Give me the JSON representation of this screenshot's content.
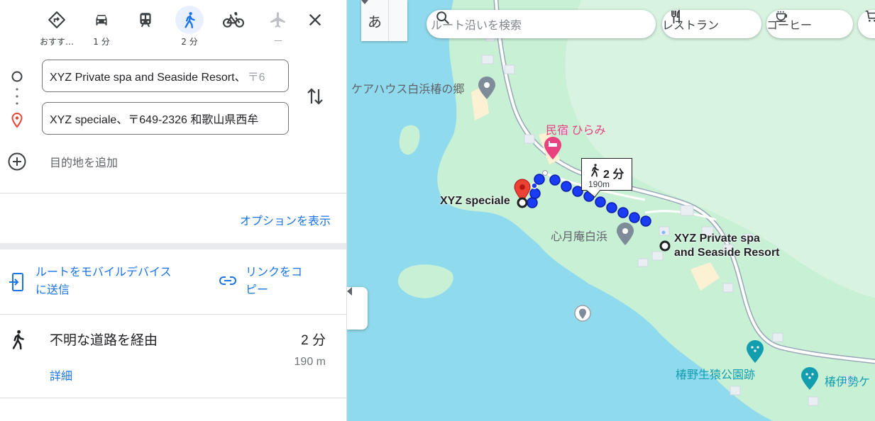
{
  "modes": [
    {
      "name": "best",
      "label": "おすす…"
    },
    {
      "name": "driving",
      "label": "1 分"
    },
    {
      "name": "transit",
      "label": ""
    },
    {
      "name": "walking",
      "label": "2 分"
    },
    {
      "name": "cycling",
      "label": ""
    },
    {
      "name": "flight",
      "label": "—"
    }
  ],
  "active_mode": "walking",
  "origin": {
    "value": "XYZ Private spa and Seaside Resort、",
    "hint": "〒6"
  },
  "destination": {
    "value": "XYZ speciale、〒649-2326 和歌山県西牟"
  },
  "add_destination": "目的地を追加",
  "options_link": "オプションを表示",
  "share_mobile": [
    "ルートをモバイルデバイス",
    "に送信"
  ],
  "share_link": [
    "リンクをコ",
    "ピー"
  ],
  "route": {
    "title": "不明な道路を経由",
    "duration": "2 分",
    "details": "詳細",
    "distance": "190 m"
  },
  "map": {
    "ime_label": "あ",
    "search_placeholder": "ルート沿いを検索",
    "chips": [
      "レストラン",
      "コーヒー"
    ],
    "places": {
      "carehouse": "ケアハウス白浜椿の郷",
      "minshuku": "民宿 ひらみ",
      "shingetsuan": "心月庵白浜",
      "park": "椿野生猿公園跡",
      "tsubaki": "椿伊勢ケ"
    },
    "dest_label": "XYZ speciale",
    "origin_label": [
      "XYZ Private spa",
      "and Seaside Resort"
    ],
    "callout": {
      "time": "2 分",
      "distance": "190m"
    }
  },
  "colors": {
    "accent": "#1a73e8",
    "route": "#1a3cf5",
    "pin_red": "#ea4335",
    "water": "#90daee",
    "land": "#c8f0d5",
    "hotel_pink": "#e8437e",
    "park_teal": "#129eaf"
  }
}
